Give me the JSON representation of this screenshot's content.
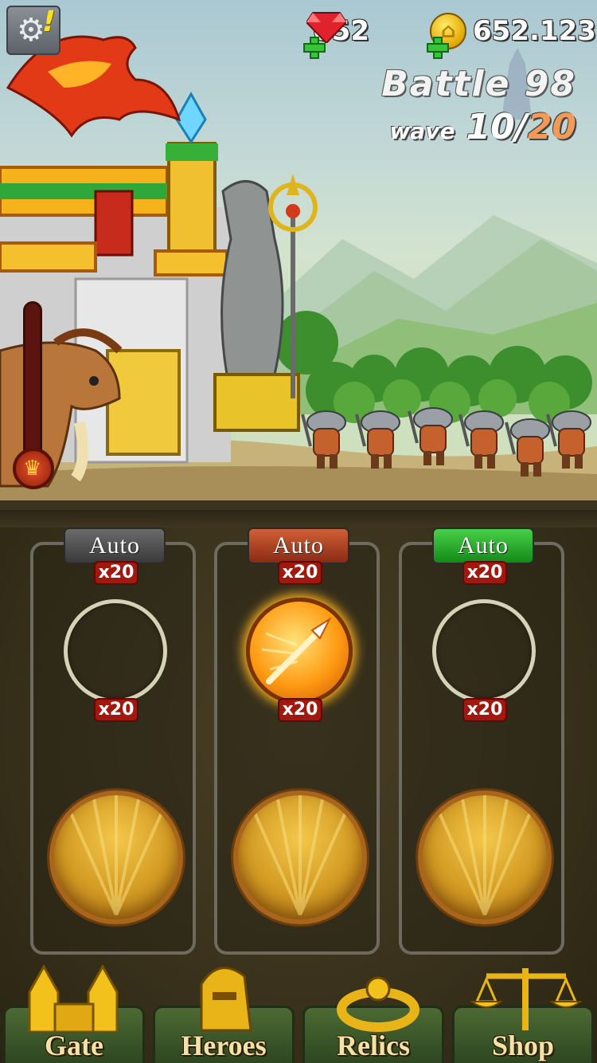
{
  "resources": {
    "gems": "652",
    "gold": "652.123"
  },
  "battle": {
    "title": "Battle 98",
    "wave_label": "wave",
    "wave_current": "10/",
    "wave_total": "20"
  },
  "mana": {
    "fill_fraction": 0.05
  },
  "slots": [
    {
      "auto_label": "Auto",
      "auto_state": "off",
      "top_count": "x20",
      "mid_count": "x20",
      "has_skill": false
    },
    {
      "auto_label": "Auto",
      "auto_state": "red",
      "top_count": "x20",
      "mid_count": "x20",
      "has_skill": true,
      "skill_icon": "spear-icon"
    },
    {
      "auto_label": "Auto",
      "auto_state": "green",
      "top_count": "x20",
      "mid_count": "x20",
      "has_skill": false
    }
  ],
  "nav": [
    {
      "label": "Gate",
      "icon": "gate-icon"
    },
    {
      "label": "Heroes",
      "icon": "helmet-icon"
    },
    {
      "label": "Relics",
      "icon": "ring-icon"
    },
    {
      "label": "Shop",
      "icon": "scales-icon"
    }
  ],
  "colors": {
    "auto_off": "#3a3a3a",
    "auto_red": "#8a2a14",
    "auto_green": "#138a18",
    "badge": "#a1180e"
  }
}
